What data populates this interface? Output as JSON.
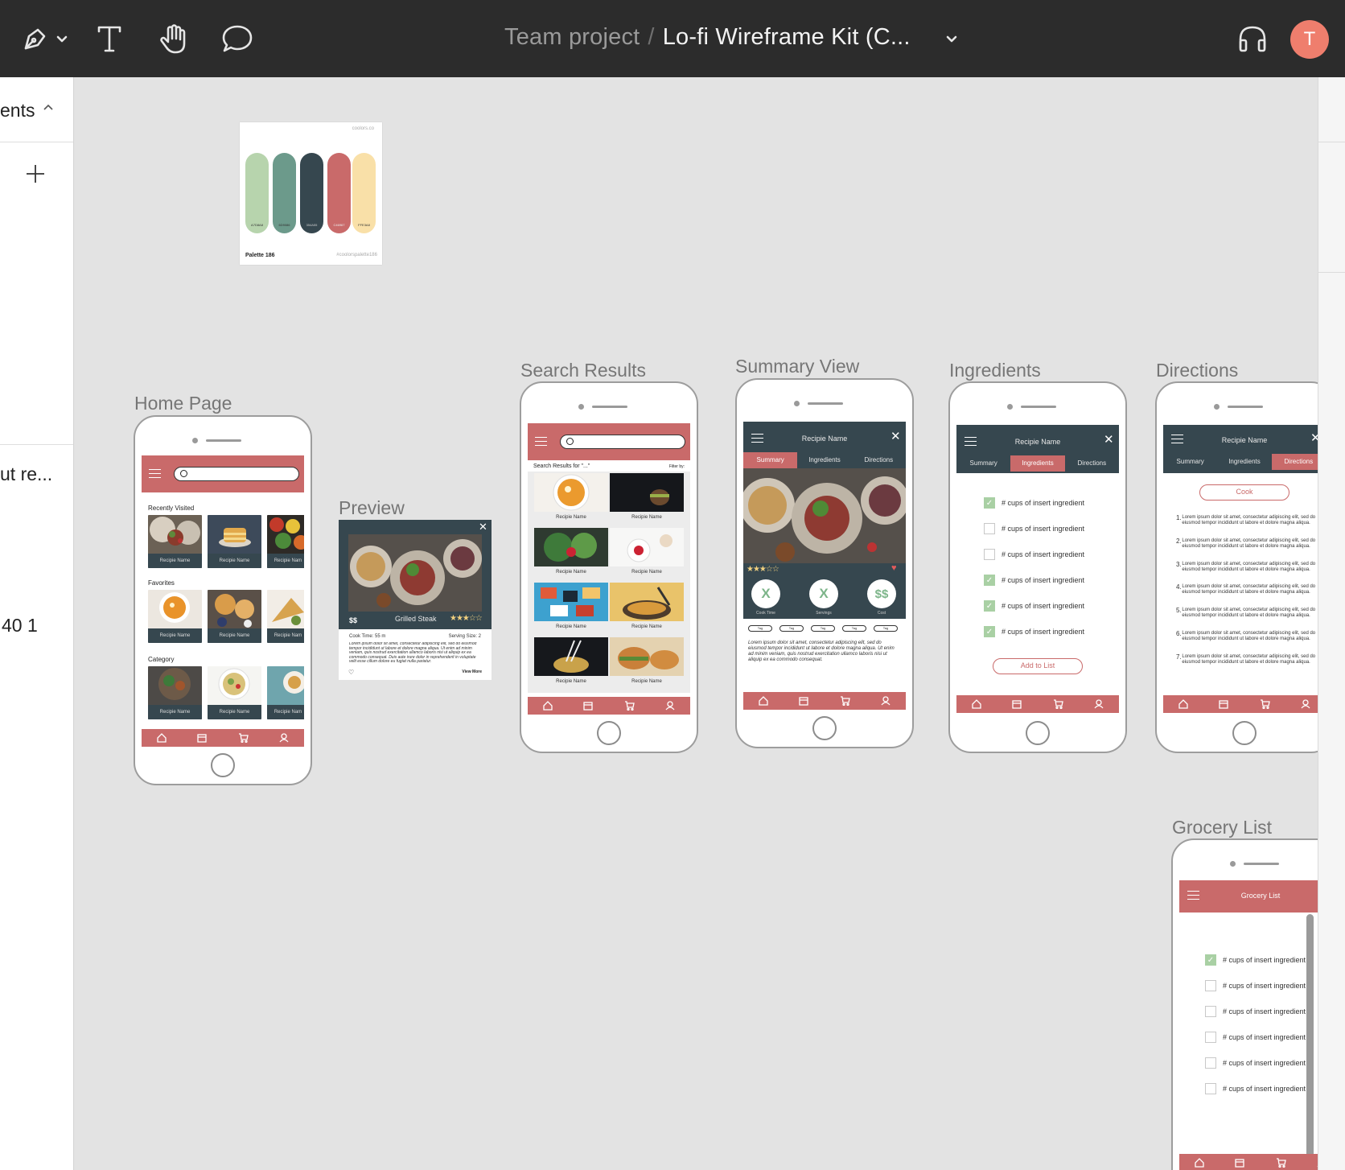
{
  "toolbar": {
    "team": "Team project",
    "separator": "/",
    "file": "Lo-fi Wireframe Kit (C...",
    "avatar": "T",
    "icons": [
      "pen-icon",
      "chevron-down-icon",
      "text-icon",
      "hand-icon",
      "comment-icon",
      "headphones-icon"
    ]
  },
  "left_panel": {
    "section": "ents",
    "item": "ut re...",
    "value": "40 1"
  },
  "palette": {
    "site": "coolors.co",
    "name": "Palette 186",
    "tag": "#coolorspalette186",
    "colors": [
      "#b7d4ad",
      "#6c9a8b",
      "#36474f",
      "#c96a6a",
      "#f9e0a8"
    ],
    "codes": [
      "A7D8A8",
      "6D9086",
      "354A55",
      "C46967",
      "FFE3A8"
    ]
  },
  "frames": {
    "home": {
      "label": "Home Page",
      "recently": "Recently Visited",
      "favorites": "Favorites",
      "category": "Category",
      "card": "Recipie Name",
      "card_cut": "Recipie Nam"
    },
    "preview": {
      "label": "Preview",
      "price": "$$",
      "name": "Grilled Steak",
      "cook_time": "Cook Time: 55 m",
      "serving": "Serving Size: 2",
      "text": "Lorem ipsum dolor sit amet, consectetur adipiscing elit, sed do eiusmod tempor incididunt ut labore et dolore magna aliqua. Ut enim ad minim veniam, quis nostrud exercitation ullamco laboris nisi ut aliquip ex ea commodo consequat. Duis aute irure dolor in reprehenderit in voluptate velit esse cillum dolore eu fugiat nulla pariatur.",
      "more": "View More"
    },
    "search": {
      "label": "Search Results",
      "results": "Search Results for \"...\"",
      "filter": "Filter by:",
      "card": "Recipie Name"
    },
    "summary": {
      "label": "Summary View",
      "title": "Recipie Name",
      "tabs": [
        "Summary",
        "Ingredients",
        "Directions"
      ],
      "stats": [
        {
          "value": "X",
          "caption": "Cook Time"
        },
        {
          "value": "X",
          "caption": "Servings"
        },
        {
          "value": "$$",
          "caption": "Cost"
        }
      ],
      "tag": "Tag",
      "text": "Lorem ipsum dolor sit amet, consectetur adipiscing elit, sed do eiusmod tempor incididunt ut labore et dolore magna aliqua. Ut enim ad minim veniam, quis nostrud exercitation ullamco laboris nisi ut aliquip ex ea commodo consequat."
    },
    "ingredients": {
      "label": "Ingredients",
      "title": "Recipie Name",
      "tabs": [
        "Summary",
        "Ingredients",
        "Directions"
      ],
      "item": "# cups of insert ingredient",
      "checked": [
        true,
        false,
        false,
        true,
        true,
        true
      ],
      "button": "Add to List"
    },
    "directions": {
      "label": "Directions",
      "title": "Recipie Name",
      "tabs": [
        "Summary",
        "Ingredients",
        "Directions"
      ],
      "button": "Cook",
      "step_text": "Lorem ipsum dolor sit amet, consectetur adipiscing elit, sed do eiusmod tempor incididunt ut labore et dolore magna aliqua.",
      "steps": [
        "1.",
        "2.",
        "3.",
        "4.",
        "5.",
        "6.",
        "7."
      ]
    },
    "grocery": {
      "label": "Grocery List",
      "title": "Grocery List",
      "item": "# cups of insert ingredient",
      "checked": [
        true,
        false,
        false,
        false,
        false,
        false
      ]
    }
  }
}
